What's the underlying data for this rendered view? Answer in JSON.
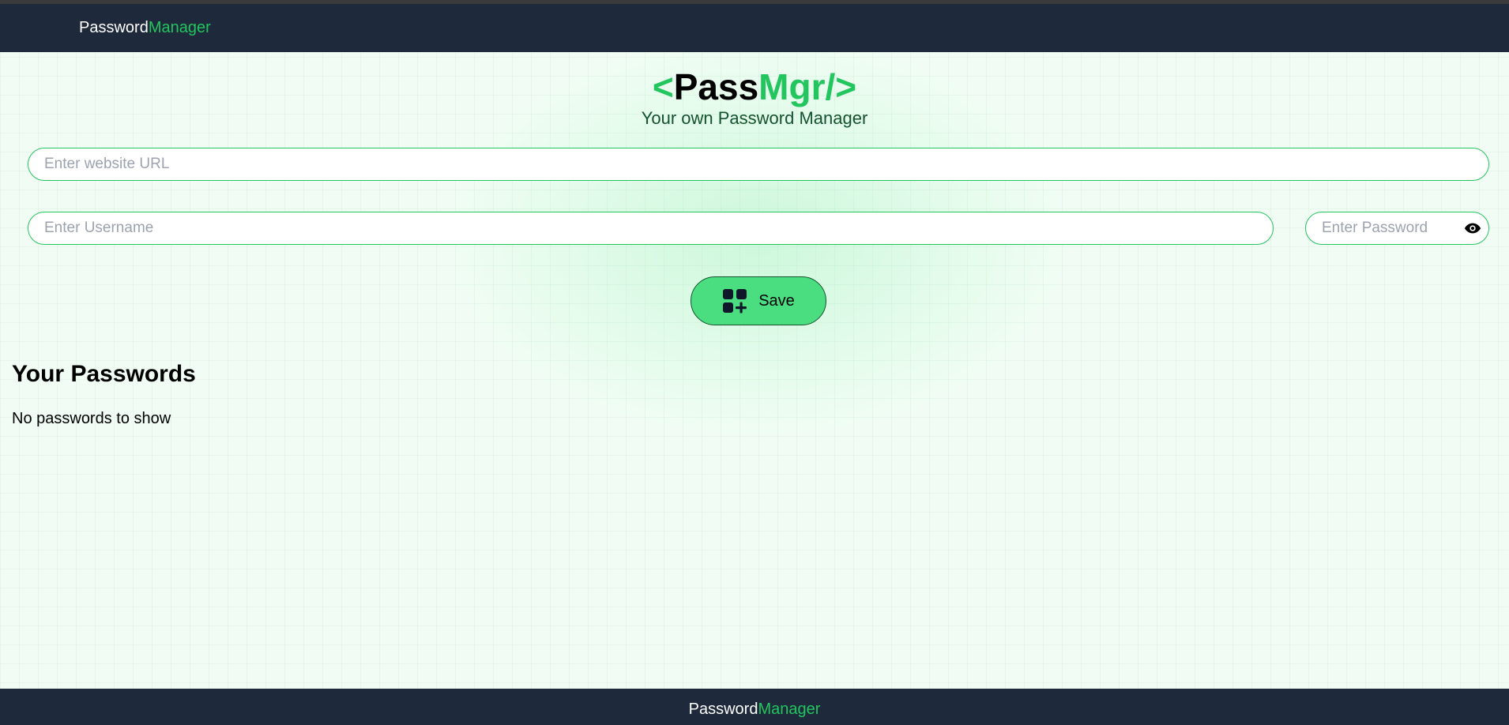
{
  "navbar": {
    "brand_part1": "Password",
    "brand_part2": "Manager"
  },
  "hero": {
    "logo_open": "<",
    "logo_pass": "Pass",
    "logo_mgr": "Mgr/>",
    "tagline": "Your own Password Manager"
  },
  "form": {
    "url_placeholder": "Enter website URL",
    "url_value": "",
    "username_placeholder": "Enter Username",
    "username_value": "",
    "password_placeholder": "Enter Password",
    "password_value": "",
    "save_label": "Save",
    "save_icon": "grid-add-icon",
    "eye_icon": "eye-icon"
  },
  "passwords": {
    "title": "Your Passwords",
    "empty_message": "No passwords to show"
  },
  "footer": {
    "brand_part1": "Password",
    "brand_part2": "Manager"
  },
  "colors": {
    "accent": "#22c55e",
    "button": "#4ade80",
    "nav_bg": "#1e293b",
    "page_bg": "#f0fdf4"
  }
}
